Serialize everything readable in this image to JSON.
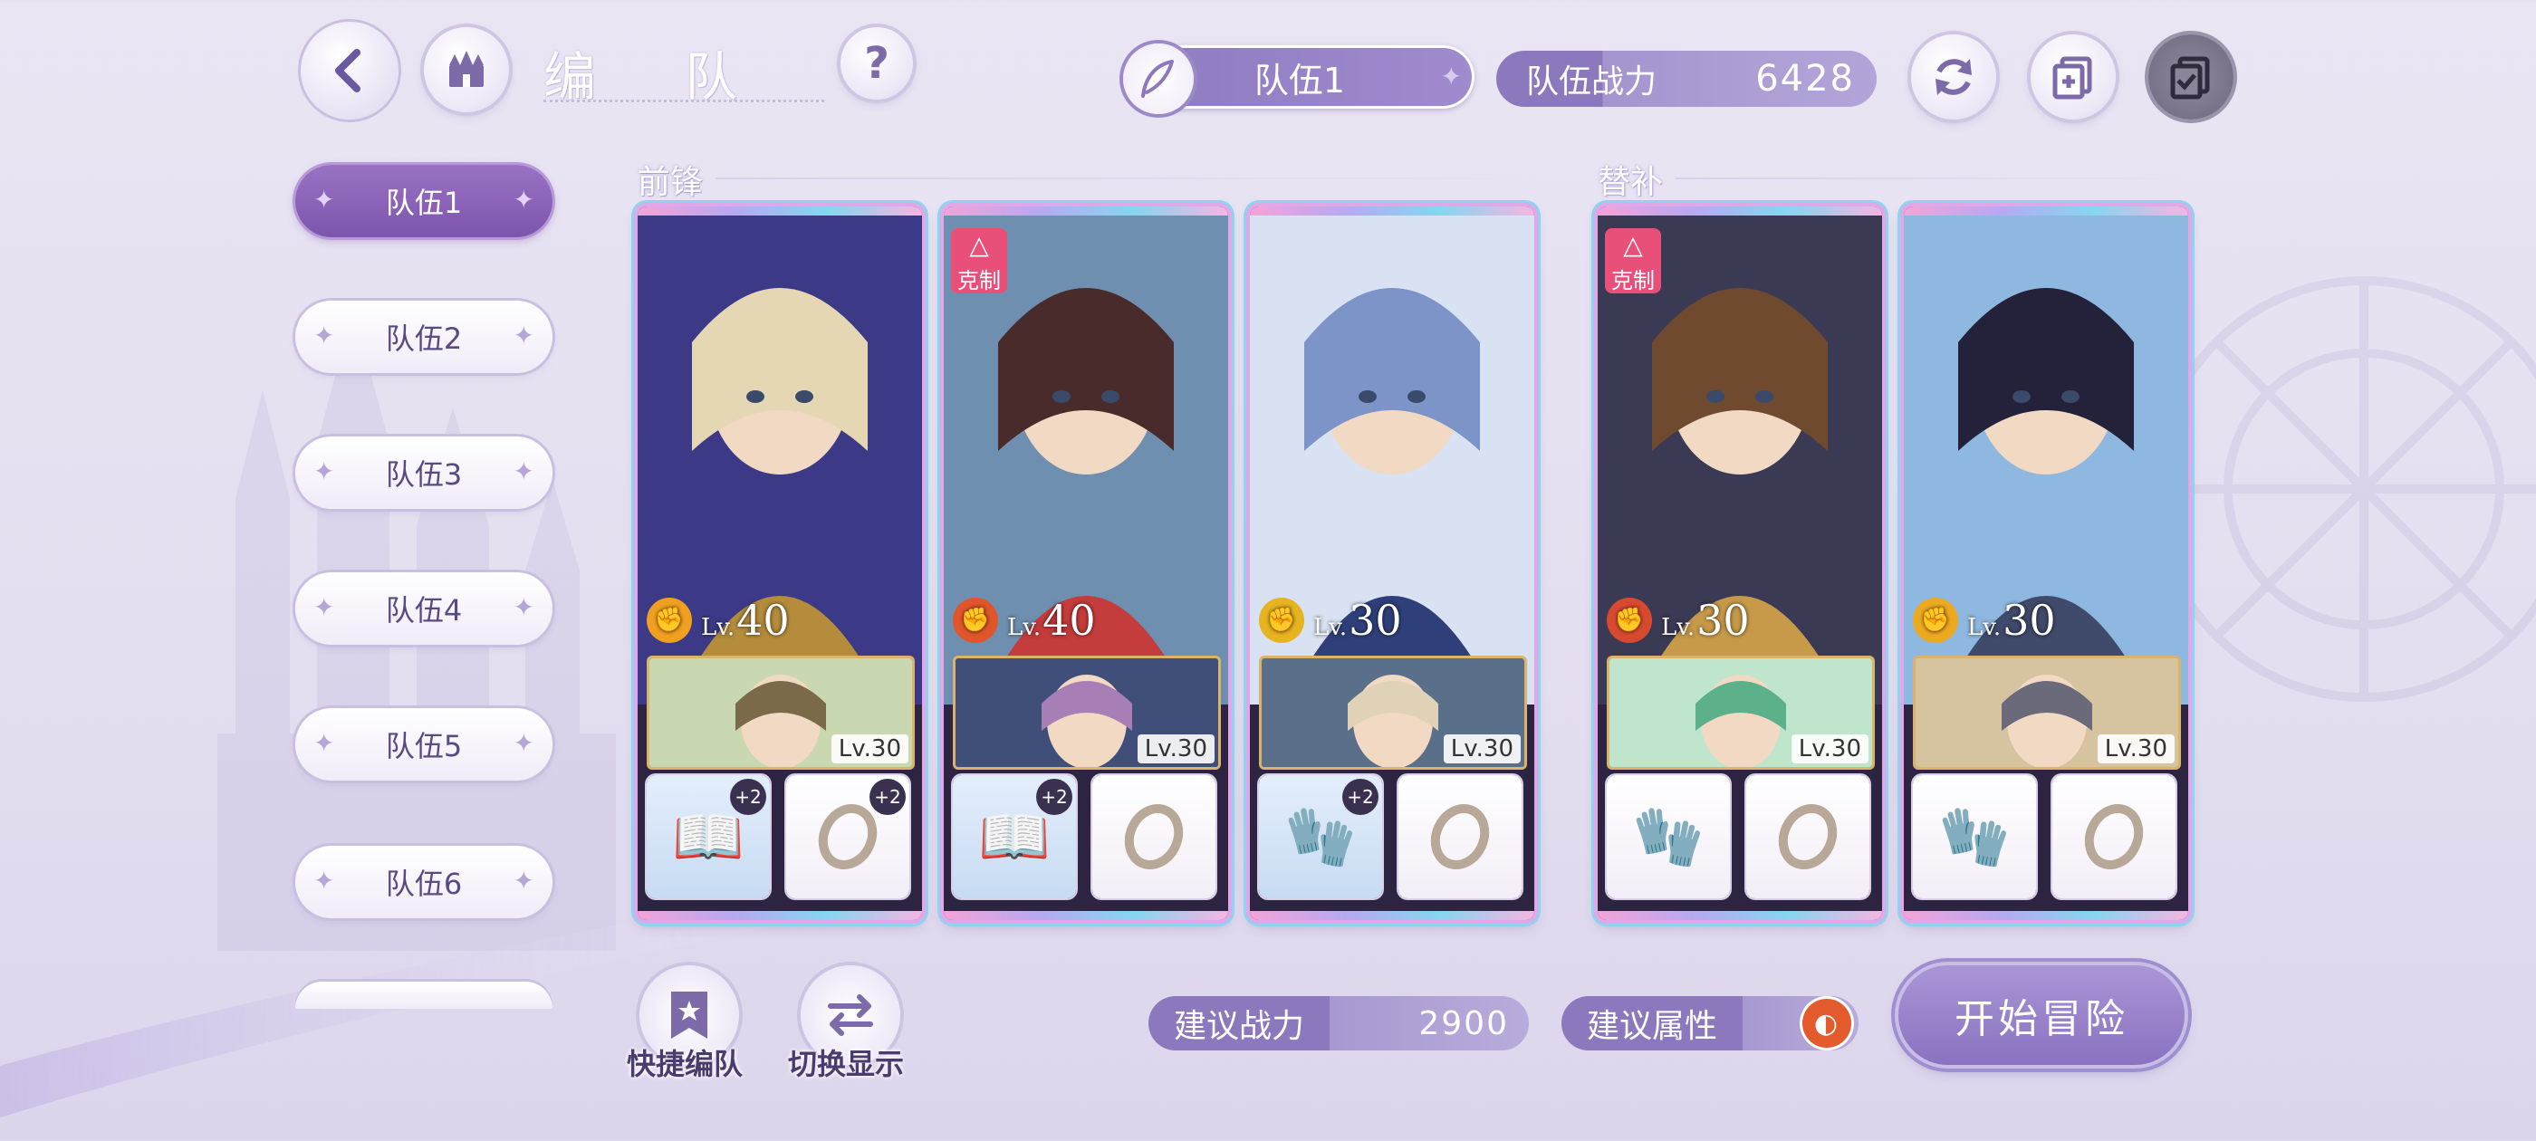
{
  "header": {
    "title": "编 队",
    "current_team": "队伍1",
    "power_label": "队伍战力",
    "power_value": "6428"
  },
  "sidebar": {
    "teams": [
      "队伍1",
      "队伍2",
      "队伍3",
      "队伍4",
      "队伍5",
      "队伍6"
    ],
    "active_index": 0
  },
  "sections": {
    "front": "前锋",
    "reserve": "替补"
  },
  "cards": [
    {
      "level_prefix": "Lv.",
      "level": "40",
      "counter": "",
      "sub_level": "Lv.30",
      "equip_left_plus": "+2",
      "equip_right_plus": "+2",
      "attr": "fire",
      "attr_color": "#f0a020"
    },
    {
      "level_prefix": "Lv.",
      "level": "40",
      "counter": "克制",
      "sub_level": "Lv.30",
      "equip_left_plus": "+2",
      "equip_right_plus": "",
      "attr": "fire",
      "attr_color": "#e0562a"
    },
    {
      "level_prefix": "Lv.",
      "level": "30",
      "counter": "",
      "sub_level": "Lv.30",
      "equip_left_plus": "+2",
      "equip_right_plus": "",
      "attr": "fist",
      "attr_color": "#e6b420"
    },
    {
      "level_prefix": "Lv.",
      "level": "30",
      "counter": "克制",
      "sub_level": "Lv.30",
      "equip_left_plus": "",
      "equip_right_plus": "",
      "attr": "fist",
      "attr_color": "#d84a30"
    },
    {
      "level_prefix": "Lv.",
      "level": "30",
      "counter": "",
      "sub_level": "Lv.30",
      "equip_left_plus": "",
      "equip_right_plus": "",
      "attr": "fist",
      "attr_color": "#ecaa20"
    }
  ],
  "bottom": {
    "quick_team": "快捷编队",
    "switch_display": "切换显示",
    "suggest_power_label": "建议战力",
    "suggest_power_value": "2900",
    "suggest_attr_label": "建议属性",
    "start": "开始冒险"
  },
  "colors": {
    "accent": "#8c78bd",
    "active_tab": "#8a60b8",
    "counter_badge": "#e8507a"
  }
}
